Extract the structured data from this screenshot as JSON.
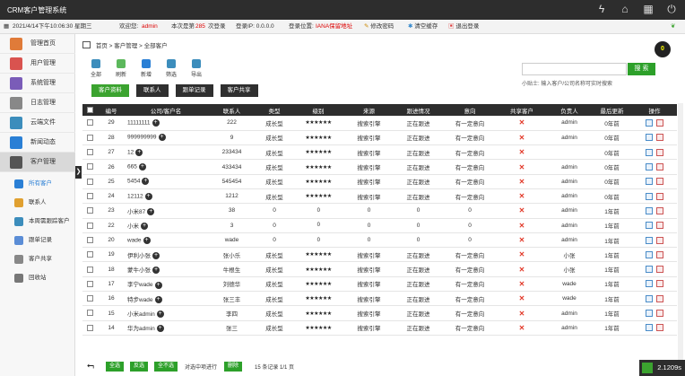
{
  "app": {
    "title": "CRM客户管理系统"
  },
  "infobar": {
    "datetime": "2021/4/14下午10:06:30 星期三",
    "welcome_label": "欢迎您:",
    "username": "admin",
    "login_prefix": "本次是第",
    "login_count": "285",
    "login_suffix": "次登录",
    "ip": "登录IP: 0.0.0.0",
    "location_label": "登录位置:",
    "location": "IANA保留地址",
    "change_password": "修改密码",
    "clear_cache": "清空缓存",
    "logout": "退出登录"
  },
  "sidebar": {
    "items": [
      {
        "label": "管理首页",
        "color": "#e07b39"
      },
      {
        "label": "用户管理",
        "color": "#d9534f"
      },
      {
        "label": "系统管理",
        "color": "#7a5cb8"
      },
      {
        "label": "日志管理",
        "color": "#888888"
      },
      {
        "label": "云端文件",
        "color": "#3c8dbc"
      },
      {
        "label": "新闻动态",
        "color": "#2a7fd5"
      },
      {
        "label": "客户管理",
        "color": "#555555"
      }
    ],
    "subitems": [
      {
        "label": "所有客户",
        "color": "#2a7fd5"
      },
      {
        "label": "联系人",
        "color": "#e0a030"
      },
      {
        "label": "本周需跟踪客户",
        "color": "#3c8dbc"
      },
      {
        "label": "跟单记录",
        "color": "#5b8dd6"
      },
      {
        "label": "客户共享",
        "color": "#888888"
      },
      {
        "label": "回收站",
        "color": "#777777"
      }
    ]
  },
  "breadcrumb": {
    "home": "首页",
    "sep1": ">",
    "level2": "客户管理",
    "sep2": ">",
    "level3": "全部客户"
  },
  "notification_count": "0",
  "toolbar": [
    {
      "label": "全部",
      "color": "#3c8dbc"
    },
    {
      "label": "刷新",
      "color": "#5cb85c"
    },
    {
      "label": "新增",
      "color": "#2a7fd5"
    },
    {
      "label": "筛选",
      "color": "#3c8dbc"
    },
    {
      "label": "导出",
      "color": "#3c8dbc"
    }
  ],
  "tabs": [
    "客户资料",
    "联系人",
    "跟单记录",
    "客户共享"
  ],
  "search": {
    "button": "搜 索",
    "hint": "小贴士: 输入客户/公司名称可实时搜索",
    "value": ""
  },
  "table": {
    "headers": [
      "编号",
      "公司/客户名",
      "联系人",
      "类型",
      "级别",
      "来源",
      "跟进情况",
      "意向",
      "共享客户",
      "负责人",
      "最后更新",
      "操作"
    ],
    "rows": [
      {
        "id": "29",
        "name": "11111111",
        "contact": "222",
        "type": "成长型",
        "level": "★★★★★★",
        "source": "搜索引擎",
        "follow": "正在跟进",
        "intent": "有一定意向",
        "owner": "admin",
        "updated": "0年前"
      },
      {
        "id": "28",
        "name": "999999999",
        "contact": "9",
        "type": "成长型",
        "level": "★★★★★★",
        "source": "搜索引擎",
        "follow": "正在跟进",
        "intent": "有一定意向",
        "owner": "admin",
        "updated": "0年前"
      },
      {
        "id": "27",
        "name": "12",
        "contact": "233434",
        "type": "成长型",
        "level": "★★★★★★",
        "source": "搜索引擎",
        "follow": "正在跟进",
        "intent": "有一定意向",
        "owner": "",
        "updated": "0年前"
      },
      {
        "id": "26",
        "name": "665",
        "contact": "433434",
        "type": "成长型",
        "level": "★★★★★★",
        "source": "搜索引擎",
        "follow": "正在跟进",
        "intent": "有一定意向",
        "owner": "admin",
        "updated": "0年前"
      },
      {
        "id": "25",
        "name": "5454",
        "contact": "545454",
        "type": "成长型",
        "level": "★★★★★★",
        "source": "搜索引擎",
        "follow": "正在跟进",
        "intent": "有一定意向",
        "owner": "admin",
        "updated": "0年前"
      },
      {
        "id": "24",
        "name": "12112",
        "contact": "1212",
        "type": "成长型",
        "level": "★★★★★★",
        "source": "搜索引擎",
        "follow": "正在跟进",
        "intent": "有一定意向",
        "owner": "admin",
        "updated": "0年前"
      },
      {
        "id": "23",
        "name": "小米87",
        "contact": "38",
        "type": "0",
        "level": "0",
        "source": "0",
        "follow": "0",
        "intent": "0",
        "owner": "admin",
        "updated": "1年前"
      },
      {
        "id": "22",
        "name": "小米",
        "contact": "3",
        "type": "0",
        "level": "0",
        "source": "0",
        "follow": "0",
        "intent": "0",
        "owner": "admin",
        "updated": "1年前"
      },
      {
        "id": "20",
        "name": "wade",
        "contact": "wade",
        "type": "0",
        "level": "0",
        "source": "0",
        "follow": "0",
        "intent": "0",
        "owner": "admin",
        "updated": "1年前"
      },
      {
        "id": "19",
        "name": "伊利小张",
        "contact": "张小乐",
        "type": "成长型",
        "level": "★★★★★★",
        "source": "搜索引擎",
        "follow": "正在跟进",
        "intent": "有一定意向",
        "owner": "小张",
        "updated": "1年前"
      },
      {
        "id": "18",
        "name": "蒙牛小张",
        "contact": "牛根生",
        "type": "成长型",
        "level": "★★★★★★",
        "source": "搜索引擎",
        "follow": "正在跟进",
        "intent": "有一定意向",
        "owner": "小张",
        "updated": "1年前"
      },
      {
        "id": "17",
        "name": "李宁wade",
        "contact": "刘德华",
        "type": "成长型",
        "level": "★★★★★★",
        "source": "搜索引擎",
        "follow": "正在跟进",
        "intent": "有一定意向",
        "owner": "wade",
        "updated": "1年前"
      },
      {
        "id": "16",
        "name": "特步wade",
        "contact": "张三丰",
        "type": "成长型",
        "level": "★★★★★★",
        "source": "搜索引擎",
        "follow": "正在跟进",
        "intent": "有一定意向",
        "owner": "wade",
        "updated": "1年前"
      },
      {
        "id": "15",
        "name": "小米admin",
        "contact": "李四",
        "type": "成长型",
        "level": "★★★★★★",
        "source": "搜索引擎",
        "follow": "正在跟进",
        "intent": "有一定意向",
        "owner": "admin",
        "updated": "1年前"
      },
      {
        "id": "14",
        "name": "华为admin",
        "contact": "张三",
        "type": "成长型",
        "level": "★★★★★★",
        "source": "搜索引擎",
        "follow": "正在跟进",
        "intent": "有一定意向",
        "owner": "admin",
        "updated": "1年前"
      }
    ]
  },
  "footer": {
    "select_all": "全选",
    "invert": "反选",
    "select_none": "全不选",
    "action_label": "对选中项进行",
    "delete": "删除",
    "summary": "15 条记录 1/1 页"
  },
  "timer": "2.1209s"
}
